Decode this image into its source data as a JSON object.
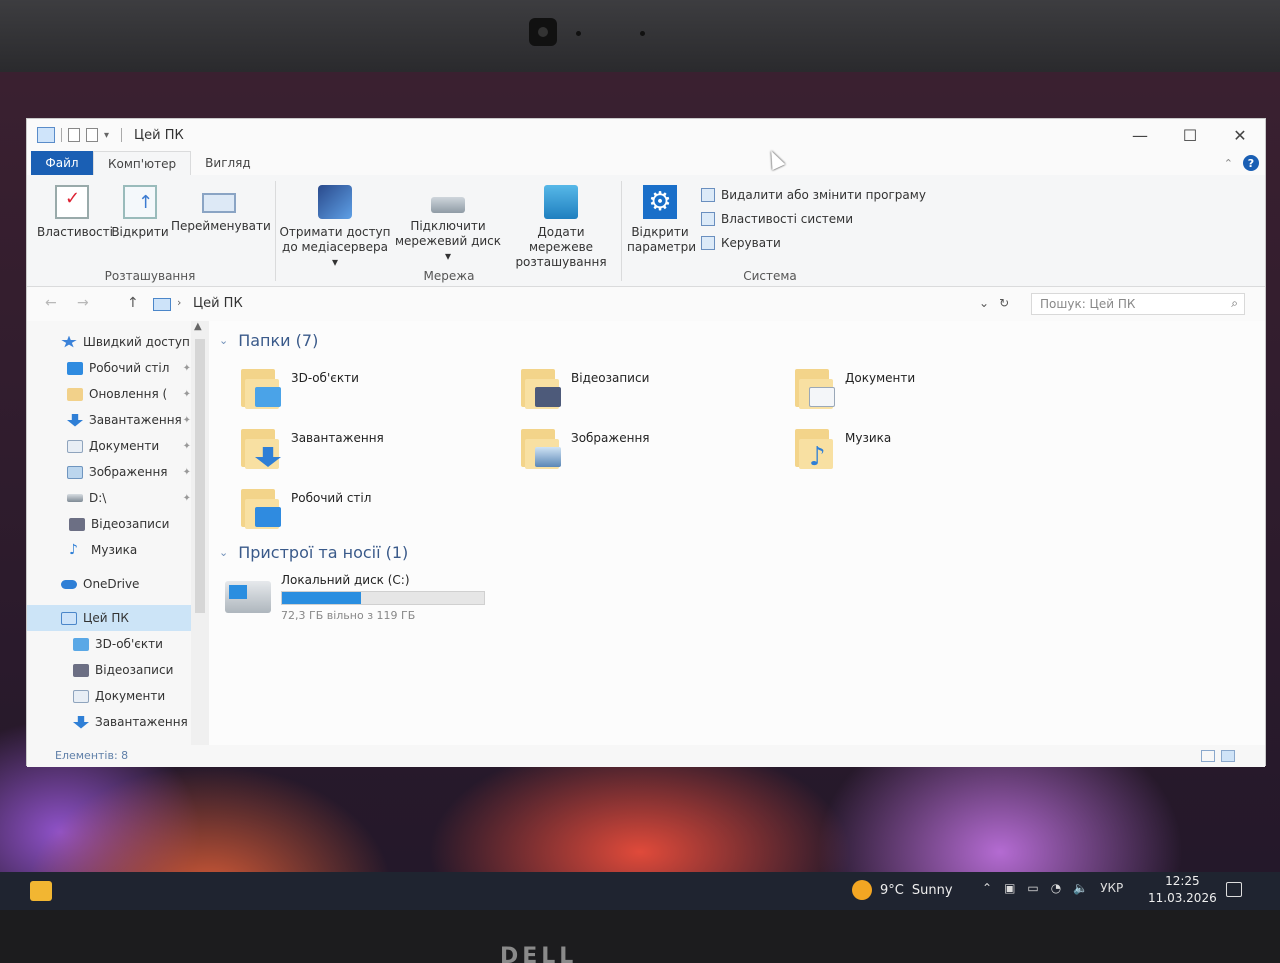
{
  "window": {
    "title": "Цей ПК",
    "controls": {
      "minimize": "—",
      "maximize": "☐",
      "close": "✕"
    }
  },
  "ribbon": {
    "tabs": [
      "Файл",
      "Комп'ютер",
      "Вигляд"
    ],
    "groups": {
      "location": {
        "label": "Розташування",
        "buttons": [
          "Властивості",
          "Відкрити",
          "Перейменувати"
        ]
      },
      "network": {
        "label": "Мережа",
        "buttons": [
          {
            "line1": "Отримати доступ",
            "line2": "до медіасервера ▾"
          },
          {
            "line1": "Підключити",
            "line2": "мережевий диск ▾"
          },
          {
            "line1": "Додати мережеве",
            "line2": "розташування"
          }
        ]
      },
      "system": {
        "label": "Система",
        "open_settings": {
          "line1": "Відкрити",
          "line2": "параметри"
        },
        "items": [
          "Видалити або змінити програму",
          "Властивості системи",
          "Керувати"
        ]
      }
    }
  },
  "address": {
    "path": "Цей ПК",
    "search_placeholder": "Пошук: Цей ПК"
  },
  "nav_pane": {
    "items": [
      {
        "label": "Швидкий доступ",
        "icon": "star-icon",
        "pinned": false
      },
      {
        "label": "Робочий стіл",
        "icon": "desktop-icon",
        "pinned": true
      },
      {
        "label": "Оновлення (",
        "icon": "folder-icon",
        "pinned": true
      },
      {
        "label": "Завантаження",
        "icon": "download-icon",
        "pinned": true
      },
      {
        "label": "Документи",
        "icon": "documents-icon",
        "pinned": true
      },
      {
        "label": "Зображення",
        "icon": "pictures-icon",
        "pinned": true
      },
      {
        "label": "D:\\",
        "icon": "drive-icon",
        "pinned": true
      },
      {
        "label": "Відеозаписи",
        "icon": "videos-icon",
        "pinned": false
      },
      {
        "label": "Музика",
        "icon": "music-icon",
        "pinned": false
      },
      {
        "label": "OneDrive",
        "icon": "cloud-icon",
        "pinned": false
      },
      {
        "label": "Цей ПК",
        "icon": "pc-icon",
        "pinned": false
      },
      {
        "label": "3D-об'єкти",
        "icon": "3d-icon",
        "pinned": false
      },
      {
        "label": "Відеозаписи",
        "icon": "videos-icon",
        "pinned": false
      },
      {
        "label": "Документи",
        "icon": "documents-icon",
        "pinned": false
      },
      {
        "label": "Завантаження",
        "icon": "download-icon",
        "pinned": false
      }
    ]
  },
  "content": {
    "folders_header": "Папки (7)",
    "folders": [
      {
        "name": "3D-об'єкти",
        "icon": "3d-objects-folder-icon"
      },
      {
        "name": "Відеозаписи",
        "icon": "videos-folder-icon"
      },
      {
        "name": "Документи",
        "icon": "documents-folder-icon"
      },
      {
        "name": "Завантаження",
        "icon": "downloads-folder-icon"
      },
      {
        "name": "Зображення",
        "icon": "pictures-folder-icon"
      },
      {
        "name": "Музика",
        "icon": "music-folder-icon"
      },
      {
        "name": "Робочий стіл",
        "icon": "desktop-folder-icon"
      }
    ],
    "devices_header": "Пристрої та носії (1)",
    "drive": {
      "name": "Локальний диск (C:)",
      "free_text": "72,3 ГБ вільно з 119 ГБ",
      "used_fraction": 0.39
    }
  },
  "status": {
    "items_text": "Елементів: 8"
  },
  "taskbar": {
    "weather": {
      "temp": "9°C",
      "condition": "Sunny"
    },
    "language": "УКР",
    "time": "12:25",
    "date": "11.03.2026"
  },
  "brand": "DELL"
}
